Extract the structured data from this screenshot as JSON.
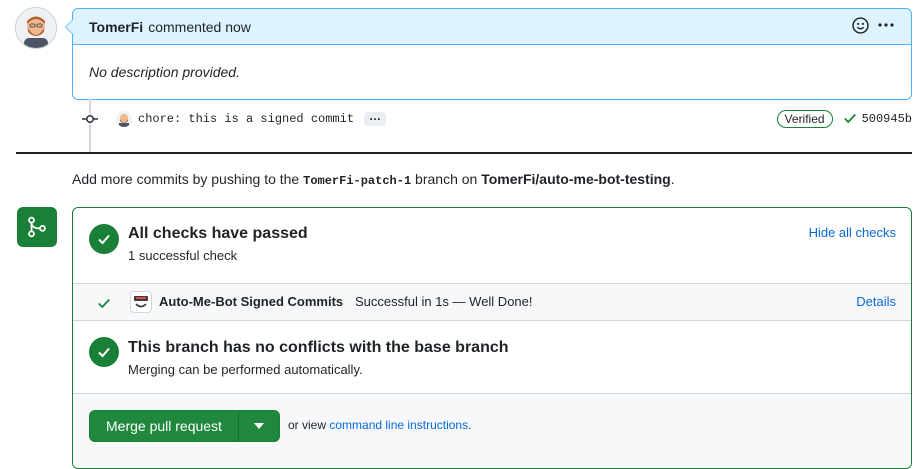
{
  "comment": {
    "author": "TomerFi",
    "action": "commented now",
    "body": "No description provided."
  },
  "commit": {
    "message": "chore: this is a signed commit",
    "ellipsis": "…",
    "verified_label": "Verified",
    "sha": "500945b"
  },
  "hint": {
    "prefix": "Add more commits by pushing to the",
    "branch": "TomerFi-patch-1",
    "middle": "branch on",
    "repo": "TomerFi/auto-me-bot-testing",
    "suffix": "."
  },
  "checks": {
    "title": "All checks have passed",
    "subtitle": "1 successful check",
    "hide_label": "Hide all checks",
    "items": [
      {
        "name": "Auto-Me-Bot Signed Commits",
        "status": "Successful in 1s — Well Done!",
        "details_label": "Details"
      }
    ]
  },
  "conflicts": {
    "title": "This branch has no conflicts with the base branch",
    "subtitle": "Merging can be performed automatically."
  },
  "merge": {
    "button_label": "Merge pull request",
    "or_view": "or view",
    "cli_link": "command line instructions",
    "suffix": "."
  },
  "colors": {
    "success": "#1a7f37",
    "header_bg": "#ddf4ff",
    "link": "#0969da"
  },
  "icons": {
    "emoji": "smiley-icon",
    "kebab": "kebab-horizontal-icon",
    "commit": "git-commit-icon",
    "check": "check-icon",
    "merge": "git-merge-icon",
    "caret": "triangle-down-icon"
  }
}
